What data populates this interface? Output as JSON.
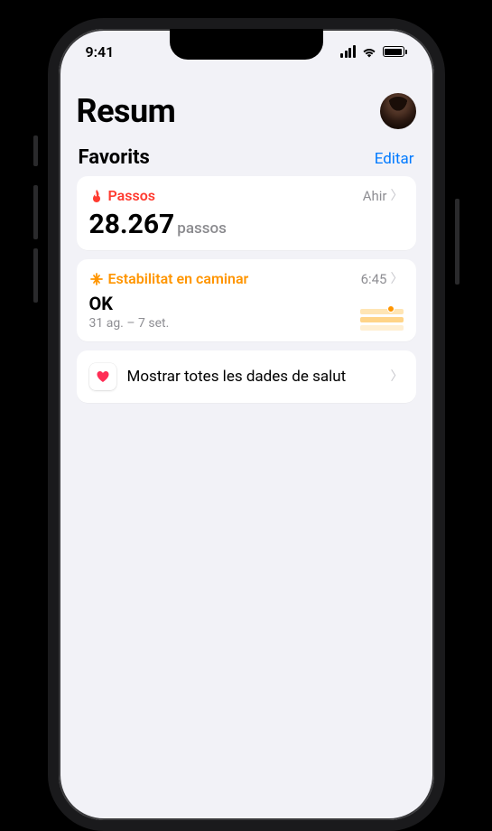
{
  "status": {
    "time": "9:41"
  },
  "header": {
    "title": "Resum"
  },
  "favorites": {
    "title": "Favorits",
    "edit_label": "Editar"
  },
  "cards": {
    "steps": {
      "label": "Passos",
      "timestamp": "Ahir",
      "value": "28.267",
      "unit": "passos",
      "accent": "#ff3b30"
    },
    "walking": {
      "label": "Estabilitat en caminar",
      "timestamp": "6:45",
      "status": "OK",
      "date_range": "31 ag. – 7 set.",
      "accent": "#ff9500"
    }
  },
  "all_data": {
    "label": "Mostrar totes les dades de salut"
  },
  "colors": {
    "link": "#007aff",
    "orange": "#ff3b30",
    "amber": "#ff9500",
    "secondary": "#8e8e93"
  }
}
